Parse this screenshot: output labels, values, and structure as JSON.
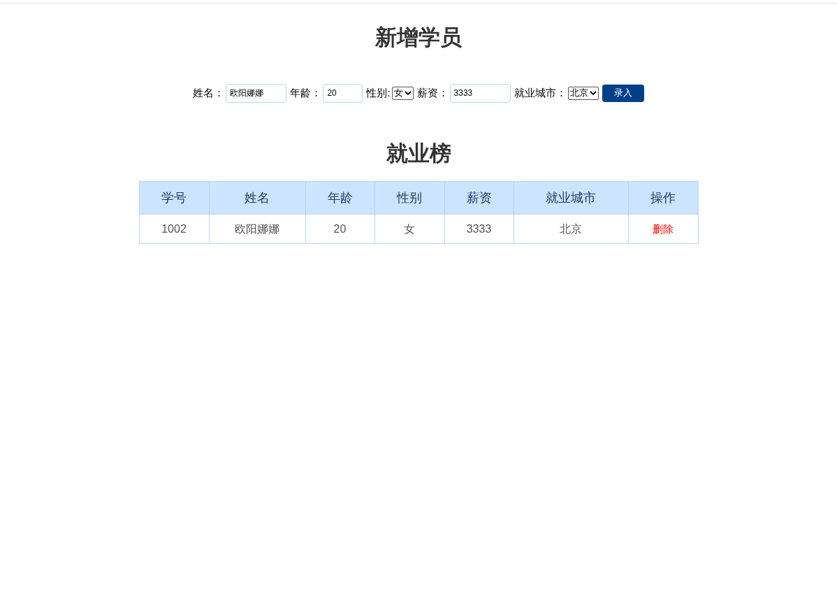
{
  "form": {
    "title": "新增学员",
    "fields": [
      {
        "kind": "text",
        "label": "姓名：",
        "value": "欧阳娜娜"
      },
      {
        "kind": "text",
        "label": "年龄：",
        "value": "20"
      },
      {
        "kind": "select",
        "label": "性别:",
        "value": "女"
      },
      {
        "kind": "text",
        "label": "薪资：",
        "value": "3333"
      },
      {
        "kind": "select",
        "label": "就业城市：",
        "value": "北京"
      }
    ],
    "submit": "录入"
  },
  "table": {
    "title": "就业榜",
    "columns": [
      "学号",
      "姓名",
      "年龄",
      "性别",
      "薪资",
      "就业城市",
      "操作"
    ],
    "rows": [
      {
        "cells": [
          "1002",
          "欧阳娜娜",
          "20",
          "女",
          "3333",
          "北京"
        ],
        "action": "删除"
      }
    ]
  }
}
